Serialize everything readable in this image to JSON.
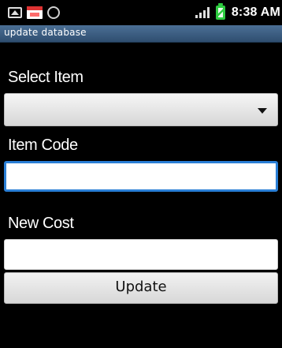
{
  "status_bar": {
    "time": "8:38 AM",
    "icons_left": [
      "image-icon",
      "calendar-icon",
      "usb-icon"
    ],
    "icons_right": [
      "signal-icon",
      "battery-charging-icon"
    ]
  },
  "window": {
    "title": "update database"
  },
  "form": {
    "select_label": "Select Item",
    "select_value": "",
    "code_label": "Item Code",
    "code_value": "",
    "cost_label": "New Cost",
    "cost_value": "",
    "update_button": "Update"
  },
  "colors": {
    "title_bar": "#3f6287",
    "focus_border": "#2a7fd6",
    "background": "#000000"
  }
}
